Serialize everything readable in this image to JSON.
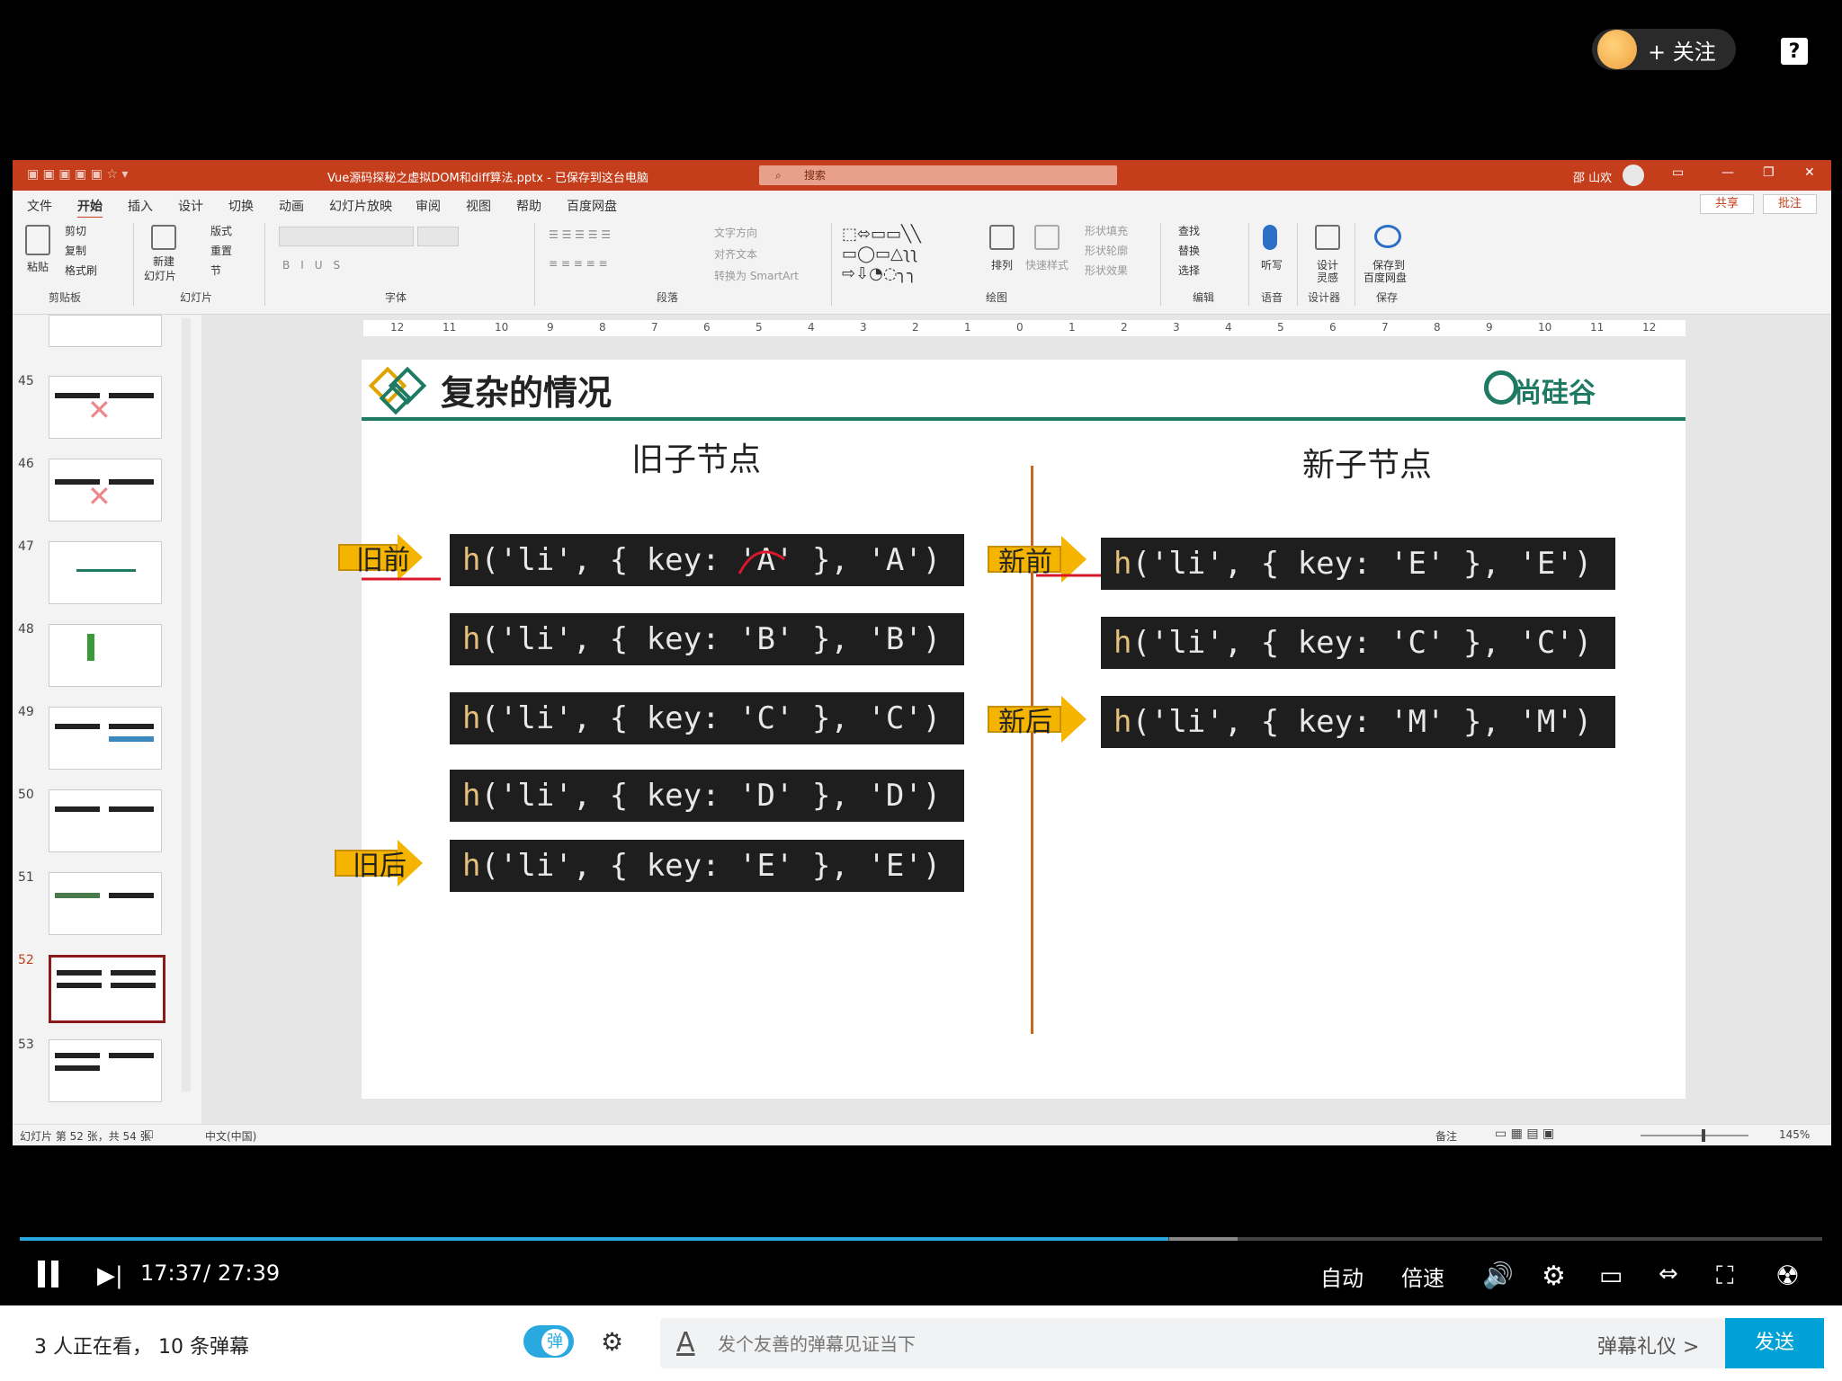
{
  "player": {
    "follow_label": "+ 关注",
    "help_icon": "?",
    "time_current": "17:37",
    "time_separator": "/",
    "time_total": "27:39",
    "progress_fraction": 0.637,
    "auto_label": "自动",
    "speed_label": "倍速",
    "viewers_text": "3 人正在看，  10 条弹幕",
    "danmu_toggle_label": "弹",
    "danmu_placeholder": "发个友善的弹幕见证当下",
    "danmu_etiquette": "弹幕礼仪 >",
    "send_label": "发送"
  },
  "ppt": {
    "title": "Vue源码探秘之虚拟DOM和diff算法.pptx - 已保存到这台电脑",
    "search_label": "搜索",
    "user": "邵 山欢",
    "tabs": [
      "文件",
      "开始",
      "插入",
      "设计",
      "切换",
      "动画",
      "幻灯片放映",
      "审阅",
      "视图",
      "帮助",
      "百度网盘"
    ],
    "active_tab": "开始",
    "share_label": "共享",
    "comment_label": "批注",
    "ribbon": {
      "clipboard": {
        "paste": "粘贴",
        "cut": "剪切",
        "copy": "复制",
        "format": "格式刷",
        "group": "剪贴板"
      },
      "slides": {
        "new": "新建",
        "new2": "幻灯片",
        "layout": "版式",
        "reset": "重置",
        "section": "节",
        "group": "幻灯片"
      },
      "font_group": "字体",
      "paragraph": {
        "text_dir": "文字方向",
        "align": "对齐文本",
        "smartart": "转换为 SmartArt",
        "group": "段落"
      },
      "drawing": {
        "arrange": "排列",
        "quick_style": "快速样式",
        "fill": "形状填充",
        "outline": "形状轮廓",
        "effect": "形状效果",
        "group": "绘图"
      },
      "editing": {
        "find": "查找",
        "replace": "替换",
        "select": "选择",
        "group": "编辑"
      },
      "voice": {
        "dictate": "听写",
        "group": "语音"
      },
      "designer": {
        "idea": "设计",
        "idea2": "灵感",
        "group": "设计器"
      },
      "save": {
        "label": "保存到",
        "label2": "百度网盘",
        "group": "保存"
      }
    },
    "thumbnails": [
      "45",
      "46",
      "47",
      "48",
      "49",
      "50",
      "51",
      "52",
      "53"
    ],
    "selected_slide": "52",
    "ruler_ticks": [
      "12",
      "11",
      "10",
      "9",
      "8",
      "7",
      "6",
      "5",
      "4",
      "3",
      "2",
      "1",
      "0",
      "1",
      "2",
      "3",
      "4",
      "5",
      "6",
      "7",
      "8",
      "9",
      "10",
      "11",
      "12"
    ],
    "status": {
      "slide_info": "幻灯片 第 52 张，共 54 张",
      "language": "中文(中国)",
      "notes": "备注",
      "zoom": "145%"
    }
  },
  "slide": {
    "title": "复杂的情况",
    "brand": "尚硅谷",
    "old_heading": "旧子节点",
    "new_heading": "新子节点",
    "old_nodes": [
      {
        "fn": "h",
        "open": "('li', { key: ",
        "key": "'A'",
        "close": " }, ",
        "text": "'A'",
        "end": ")"
      },
      {
        "fn": "h",
        "open": "('li', { key: ",
        "key": "'B'",
        "close": " }, ",
        "text": "'B'",
        "end": ")"
      },
      {
        "fn": "h",
        "open": "('li', { key: ",
        "key": "'C'",
        "close": " }, ",
        "text": "'C'",
        "end": ")"
      },
      {
        "fn": "h",
        "open": "('li', { key: ",
        "key": "'D'",
        "close": " }, ",
        "text": "'D'",
        "end": ")"
      },
      {
        "fn": "h",
        "open": "('li', { key: ",
        "key": "'E'",
        "close": " }, ",
        "text": "'E'",
        "end": ")"
      }
    ],
    "new_nodes": [
      {
        "fn": "h",
        "open": "('li', { key: ",
        "key": "'E'",
        "close": " }, ",
        "text": "'E'",
        "end": ")"
      },
      {
        "fn": "h",
        "open": "('li', { key: ",
        "key": "'C'",
        "close": " }, ",
        "text": "'C'",
        "end": ")"
      },
      {
        "fn": "h",
        "open": "('li', { key: ",
        "key": "'M'",
        "close": " }, ",
        "text": "'M'",
        "end": ")"
      }
    ],
    "pointers": {
      "old_start": "旧前",
      "old_end": "旧后",
      "new_start": "新前",
      "new_end": "新后"
    },
    "colors": {
      "accent": "#1f7a64",
      "pointer": "#f5b400",
      "divider": "#c8651f",
      "code_bg": "#1e1e1e",
      "ppt_red": "#c43e1c"
    }
  }
}
